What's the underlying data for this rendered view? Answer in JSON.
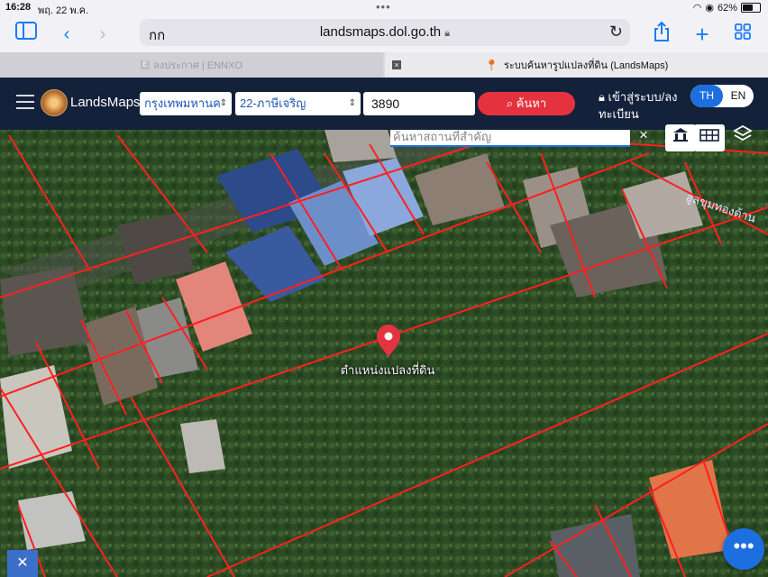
{
  "status_bar": {
    "time": "16:28",
    "date": "พฤ. 22 พ.ค.",
    "battery": "62%",
    "battery_level": 0.62
  },
  "browser": {
    "aa_label": "กก",
    "url": "landsmaps.dol.go.th",
    "tabs": [
      {
        "title": "ลงประกาศ | ENNXO",
        "favicon": "E"
      },
      {
        "title": "ระบบค้นหารูปแปลงที่ดิน (LandsMaps)"
      }
    ]
  },
  "header": {
    "brand": "LandsMaps",
    "province": "กรุงเทพมหานค",
    "district": "22-ภาษีเจริญ",
    "parcel_number": "3890",
    "search_label": "ค้นหา",
    "login_label": "เข้าสู่ระบบ/ลงทะเบียน",
    "lang_th": "TH",
    "lang_en": "EN"
  },
  "map": {
    "place_search_placeholder": "ค้นหาสถานที่สำคัญ",
    "clear_label": "×",
    "pin_label": "ตำแหน่งแปลงที่ดิน",
    "road_label": "อูลขุมทองด้าน",
    "colors": {
      "parcel_line": "#ff2020",
      "pin": "#e5323f",
      "accent": "#1d6fe0",
      "header": "#14213a"
    }
  },
  "icons": {
    "sidebar": "sidebar-icon",
    "back": "back-icon",
    "forward": "forward-icon",
    "lock": "lock-icon",
    "reload": "reload-icon",
    "share": "share-icon",
    "new_tab": "plus-icon",
    "tabs": "tabs-grid-icon",
    "menu": "hamburger-icon",
    "home": "building-icon",
    "grid": "grid-icon",
    "layers": "layers-icon",
    "measure": "measure-tool-icon",
    "more": "more-icon"
  }
}
